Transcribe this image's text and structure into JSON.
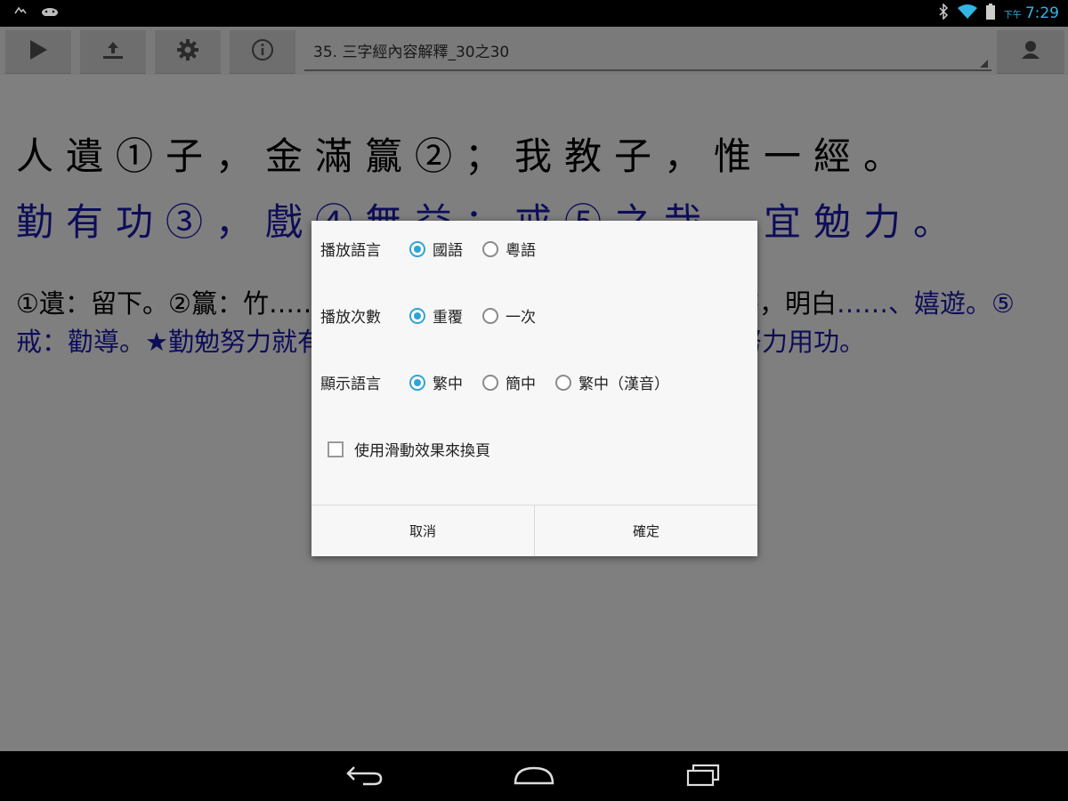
{
  "status_bar": {
    "ampm": "下午",
    "time": "7:29"
  },
  "toolbar": {
    "title": "35. 三字經內容解釋_30之30"
  },
  "content": {
    "verse_line1": "人遺①子，金滿籯②；我教子，惟一經。",
    "verse_line2": "勤有功③，戲④無益；戒⑤之哉，宜勉力。",
    "para_black": "①遺：留下。②籯：竹……的金銀財寶；我只教導子孫要多讀經書，明白",
    "para_blue": "……、嬉遊。⑤戒：勸導。★勤勉努力就有收獲，……此為戒，時時警惕自己要努力用功。"
  },
  "dialog": {
    "play_language": {
      "label": "播放語言",
      "options": [
        "國語",
        "粵語"
      ],
      "selected": "國語"
    },
    "play_count": {
      "label": "播放次數",
      "options": [
        "重覆",
        "一次"
      ],
      "selected": "重覆"
    },
    "display_language": {
      "label": "顯示語言",
      "options": [
        "繁中",
        "簡中",
        "繁中（漢音）"
      ],
      "selected": "繁中"
    },
    "swipe_checkbox": {
      "label": "使用滑動效果來換頁",
      "checked": false
    },
    "cancel_label": "取消",
    "ok_label": "確定"
  },
  "colors": {
    "accent": "#2fa3d6",
    "verse_blue": "#1b1bb0",
    "status_blue": "#33b5e5"
  }
}
